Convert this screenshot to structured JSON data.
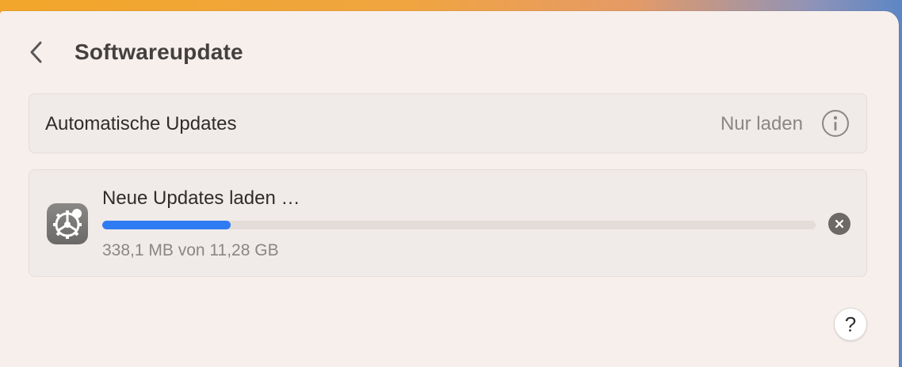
{
  "header": {
    "back_icon": "chevron-left-icon",
    "title": "Softwareupdate"
  },
  "automatic_updates": {
    "label": "Automatische Updates",
    "value": "Nur laden",
    "info_icon": "info-circle-icon"
  },
  "download": {
    "app_icon": "system-settings-gear-icon",
    "title": "Neue Updates laden …",
    "progress_fraction": 0.18,
    "size_text": "338,1 MB von 11,28 GB",
    "cancel_icon": "close-circle-icon"
  },
  "help": {
    "label": "?"
  },
  "colors": {
    "accent": "#2f7bf4",
    "window_bg": "#f6efec",
    "panel_bg": "#f0ebe8"
  }
}
